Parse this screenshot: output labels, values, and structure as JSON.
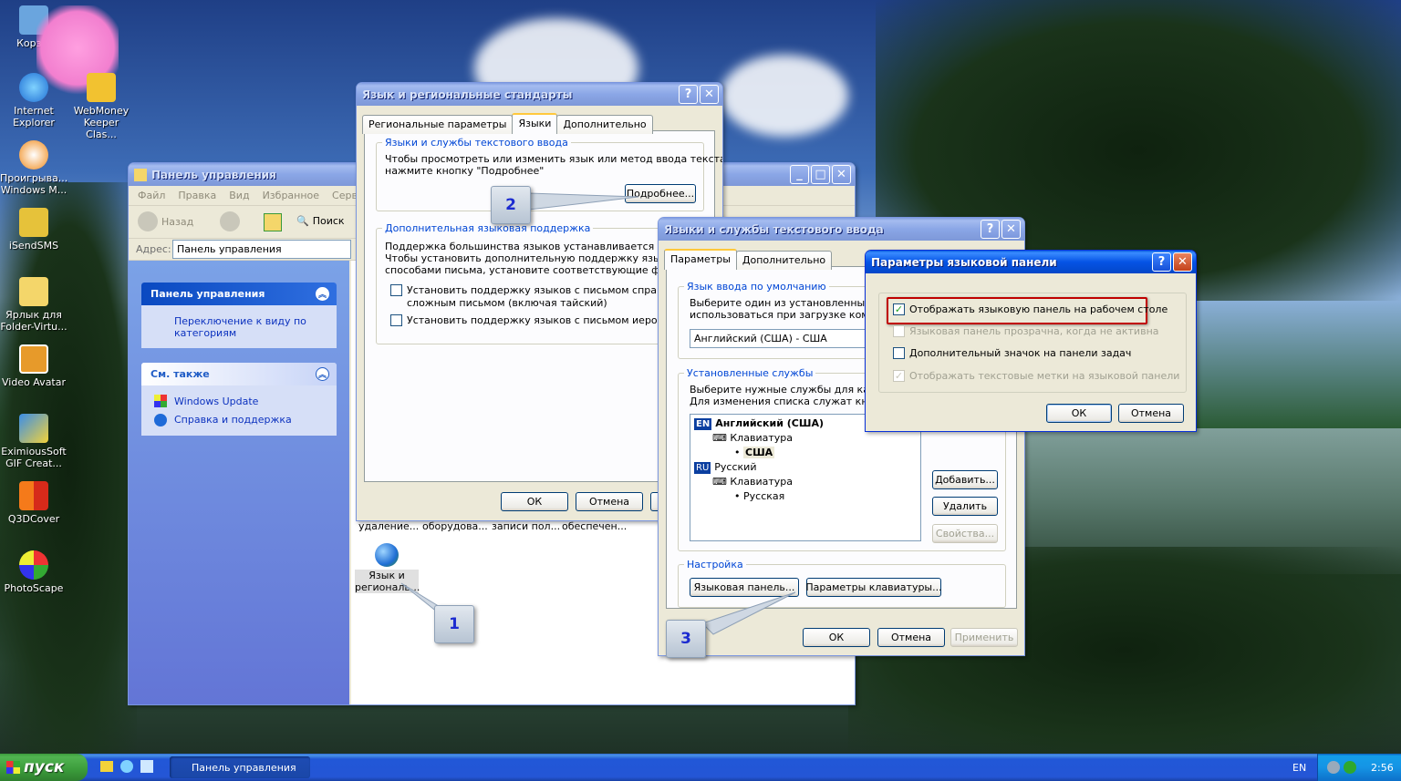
{
  "desktop": {
    "icons": [
      {
        "label": "Корз...",
        "icon": "recycle-bin-icon"
      },
      {
        "label": "Internet Explorer",
        "icon": "internet-explorer-icon"
      },
      {
        "label": "WebMoney Keeper Clas...",
        "icon": "webmoney-icon"
      },
      {
        "label": "Проигрыва... Windows M...",
        "icon": "media-player-icon"
      },
      {
        "label": "iSendSMS",
        "icon": "isendsms-icon"
      },
      {
        "label": "Ярлык для Folder-Virtu...",
        "icon": "folder-shortcut-icon"
      },
      {
        "label": "Video Avatar",
        "icon": "video-avatar-icon"
      },
      {
        "label": "EximiousSoft GIF Creat...",
        "icon": "gif-creator-icon"
      },
      {
        "label": "Q3DCover",
        "icon": "q3dcover-icon"
      },
      {
        "label": "PhotoScape",
        "icon": "photoscape-icon"
      }
    ]
  },
  "control_panel": {
    "title": "Панель управления",
    "menu": [
      "Файл",
      "Правка",
      "Вид",
      "Избранное",
      "Сервис"
    ],
    "toolbar": {
      "back": "Назад",
      "search": "Поиск"
    },
    "address_label": "Адрес:",
    "address_value": "Панель управления",
    "side_panel": {
      "title": "Панель управления",
      "switch_link": "Переключение к виду по категориям"
    },
    "see_also": {
      "title": "См. также",
      "links": [
        "Windows Update",
        "Справка и поддержка"
      ]
    },
    "items_truncated": [
      "удаление...",
      "оборудова...",
      "записи пол...",
      "обеспечен..."
    ],
    "regional_item": "Язык и региональ..."
  },
  "regional_dialog": {
    "title": "Язык и региональные стандарты",
    "tabs": [
      "Региональные параметры",
      "Языки",
      "Дополнительно"
    ],
    "group1_label": "Языки и службы текстового ввода",
    "group1_text": [
      "Чтобы просмотреть или изменить язык или метод ввода текста,",
      "нажмите кнопку \"Подробнее\""
    ],
    "details_button": "Подробнее...",
    "group2_label": "Дополнительная языковая поддержка",
    "group2_text": [
      "Поддержка большинства языков устанавливается по умол",
      "Чтобы установить дополнительную поддержку языков с ос",
      "способами письма, установите соответствующие флажки."
    ],
    "checkbox1": [
      "Установить поддержку языков с письмом справа нал",
      "сложным письмом (включая тайский)"
    ],
    "checkbox2": "Установить поддержку языков с письмом иероглиф",
    "ok": "ОК",
    "cancel": "Отмена"
  },
  "text_services_dialog": {
    "title": "Языки и службы текстового ввода",
    "tabs": [
      "Параметры",
      "Дополнительно"
    ],
    "default_group": "Язык ввода по умолчанию",
    "default_text": [
      "Выберите один из установленных язы",
      "использоваться при загрузке компь"
    ],
    "default_select": "Английский (США) - США",
    "installed_group": "Установленные службы",
    "installed_text": [
      "Выберите нужные службы для каждо",
      "Для изменения списка служат кнопк"
    ],
    "services": [
      {
        "badge": "EN",
        "lang": "Английский (США)",
        "category": "Клавиатура",
        "layout": "США"
      },
      {
        "badge": "RU",
        "lang": "Русский",
        "category": "Клавиатура",
        "layout": "Русская"
      }
    ],
    "add_button": "Добавить...",
    "remove_button": "Удалить",
    "props_button": "Свойства...",
    "settings_group": "Настройка",
    "langbar_button": "Языковая панель...",
    "keyboard_button": "Параметры клавиатуры...",
    "ok": "ОК",
    "cancel": "Отмена",
    "apply": "Применить"
  },
  "langbar_dialog": {
    "title": "Параметры языковой панели",
    "options": [
      {
        "label": "Отображать языковую панель на рабочем столе",
        "checked": true,
        "disabled": false
      },
      {
        "label": "Языковая панель прозрачна, когда не активна",
        "checked": false,
        "disabled": true
      },
      {
        "label": "Дополнительный значок на панели задач",
        "checked": false,
        "disabled": false
      },
      {
        "label": "Отображать текстовые метки на языковой панели",
        "checked": true,
        "disabled": true
      }
    ],
    "ok": "ОК",
    "cancel": "Отмена"
  },
  "callouts": [
    "1",
    "2",
    "3"
  ],
  "taskbar": {
    "start": "пуск",
    "task": "Панель управления",
    "lang": "EN",
    "time": "2:56"
  },
  "colors": {
    "xp_blue": "#0553e5",
    "highlight_red": "#c00000"
  }
}
